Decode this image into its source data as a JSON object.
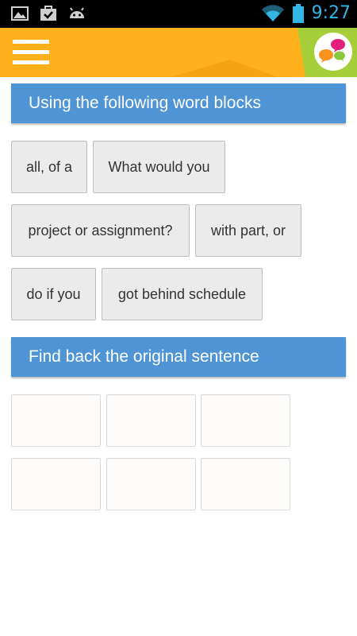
{
  "status_bar": {
    "icons_left": [
      "image-icon",
      "briefcase-check-icon",
      "android-icon"
    ],
    "icons_right": [
      "wifi-icon",
      "battery-icon"
    ],
    "time": "9:27",
    "accent_color": "#33b5e5"
  },
  "app_header": {
    "background_color": "#ffb11b",
    "accent_color": "#a6ce39",
    "menu_icon": "hamburger-menu-icon",
    "logo_icon": "speech-bubbles-logo-icon"
  },
  "instructions": {
    "word_blocks_title": "Using the following word blocks",
    "sentence_title": "Find back the original sentence",
    "header_color": "#4f94d4"
  },
  "word_blocks": [
    {
      "text": "all, of a"
    },
    {
      "text": "What would you"
    },
    {
      "text": "project or assignment?"
    },
    {
      "text": "with part, or"
    },
    {
      "text": "do if you"
    },
    {
      "text": "got behind schedule"
    }
  ],
  "answer_slots": [
    "",
    "",
    "",
    "",
    "",
    ""
  ]
}
